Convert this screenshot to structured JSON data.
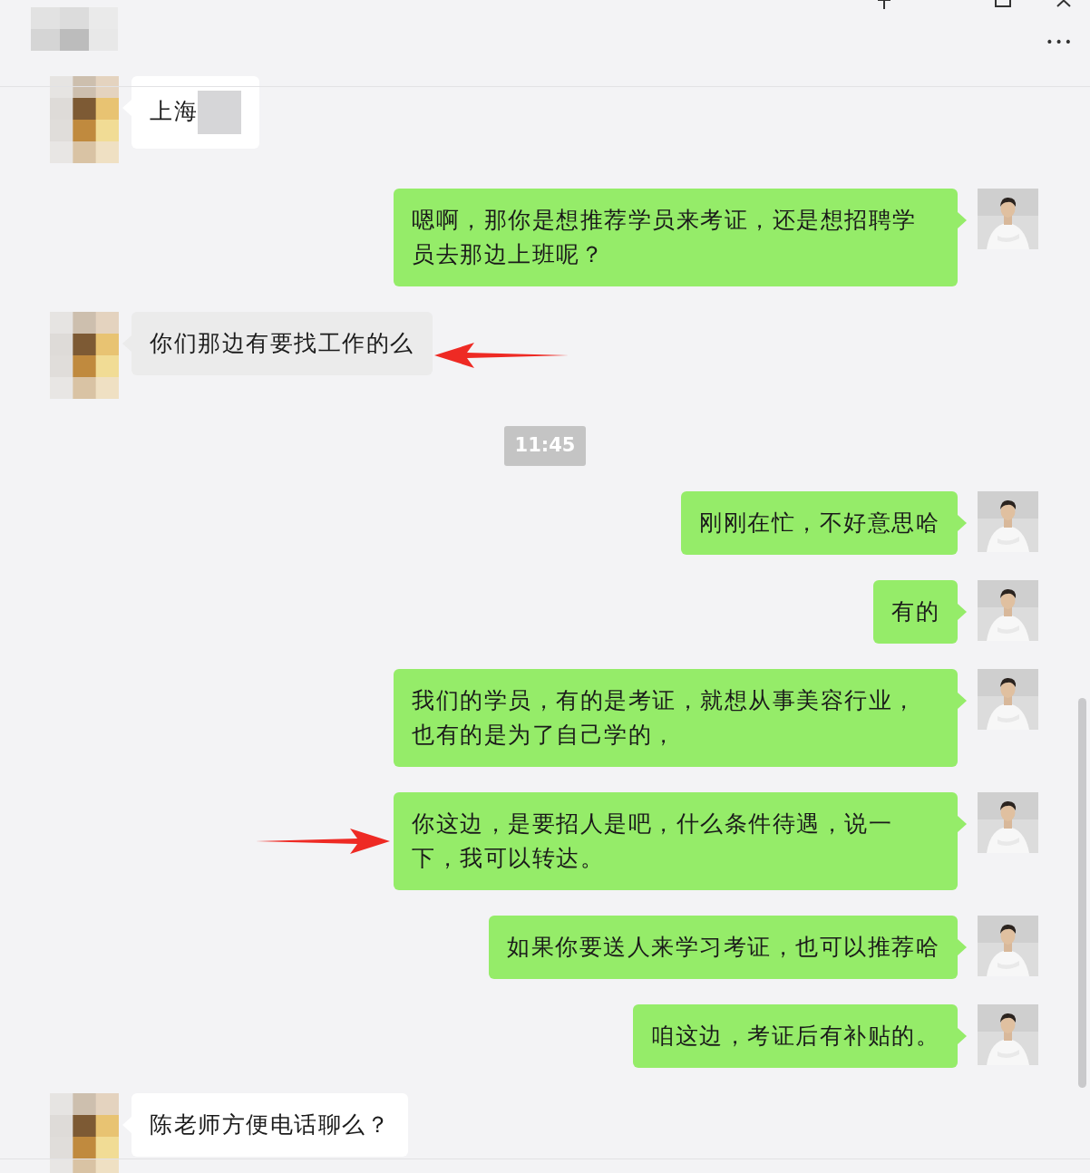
{
  "header": {
    "more_button": "•••"
  },
  "messages": [
    {
      "kind": "incoming",
      "text": "上海",
      "hovered": false,
      "marked": false,
      "redacted": true
    },
    {
      "kind": "outgoing",
      "text": "嗯啊，那你是想推荐学员来考证，还是想招聘学员去那边上班呢？",
      "marked": false
    },
    {
      "kind": "incoming",
      "text": "你们那边有要找工作的么",
      "hovered": true,
      "marked": true,
      "redacted": false
    },
    {
      "kind": "time",
      "text": "11:45"
    },
    {
      "kind": "outgoing",
      "text": "刚刚在忙，不好意思哈",
      "marked": false
    },
    {
      "kind": "outgoing",
      "text": "有的",
      "marked": false
    },
    {
      "kind": "outgoing",
      "text": "我们的学员，有的是考证，就想从事美容行业，也有的是为了自己学的，",
      "marked": false
    },
    {
      "kind": "outgoing",
      "text": "你这边，是要招人是吧，什么条件待遇，说一下，我可以转达。",
      "marked": true
    },
    {
      "kind": "outgoing",
      "text": "如果你要送人来学习考证，也可以推荐哈",
      "marked": false
    },
    {
      "kind": "outgoing",
      "text": "咱这边，考证后有补贴的。",
      "marked": false
    },
    {
      "kind": "incoming",
      "text": "陈老师方便电话聊么？",
      "hovered": false,
      "marked": false,
      "redacted": false
    }
  ]
}
